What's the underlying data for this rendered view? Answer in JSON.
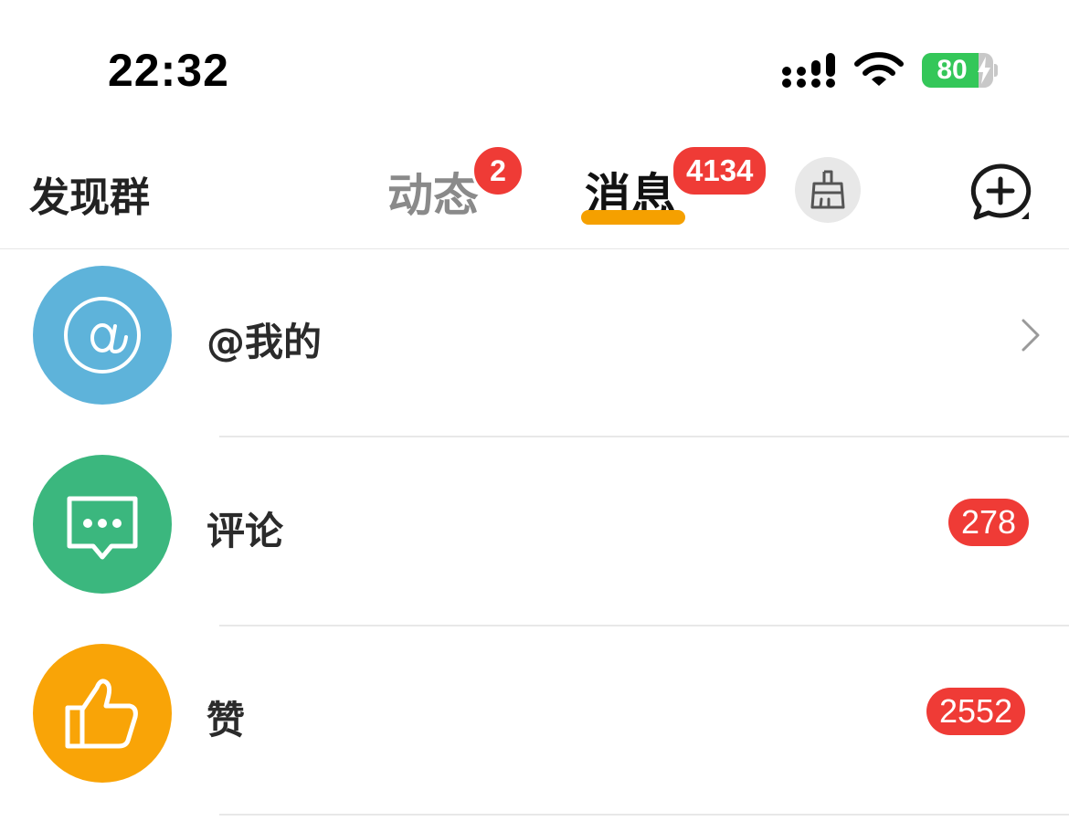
{
  "status_bar": {
    "time": "22:32",
    "battery_percent": "80",
    "battery_level": 0.8,
    "signal_icon": "cellular-signal-icon",
    "wifi_icon": "wifi-icon",
    "battery_icon": "battery-charging-icon"
  },
  "nav": {
    "discover_label": "发现群",
    "tabs": [
      {
        "label": "动态",
        "badge": "2",
        "active": false
      },
      {
        "label": "消息",
        "badge": "4134",
        "active": true
      }
    ],
    "clean_icon": "broom-icon",
    "new_chat_icon": "chat-add-icon",
    "active_color": "#f5a000"
  },
  "list": [
    {
      "label": "@我的",
      "icon": "at-icon",
      "icon_bg": "#5eb3da",
      "trailing": "chevron-right-icon"
    },
    {
      "label": "评论",
      "icon": "comment-dots-icon",
      "icon_bg": "#3bb77e",
      "count": "278"
    },
    {
      "label": "赞",
      "icon": "thumbs-up-icon",
      "icon_bg": "#f9a407",
      "count": "2552"
    }
  ],
  "colors": {
    "badge_red": "#ef3b36"
  }
}
